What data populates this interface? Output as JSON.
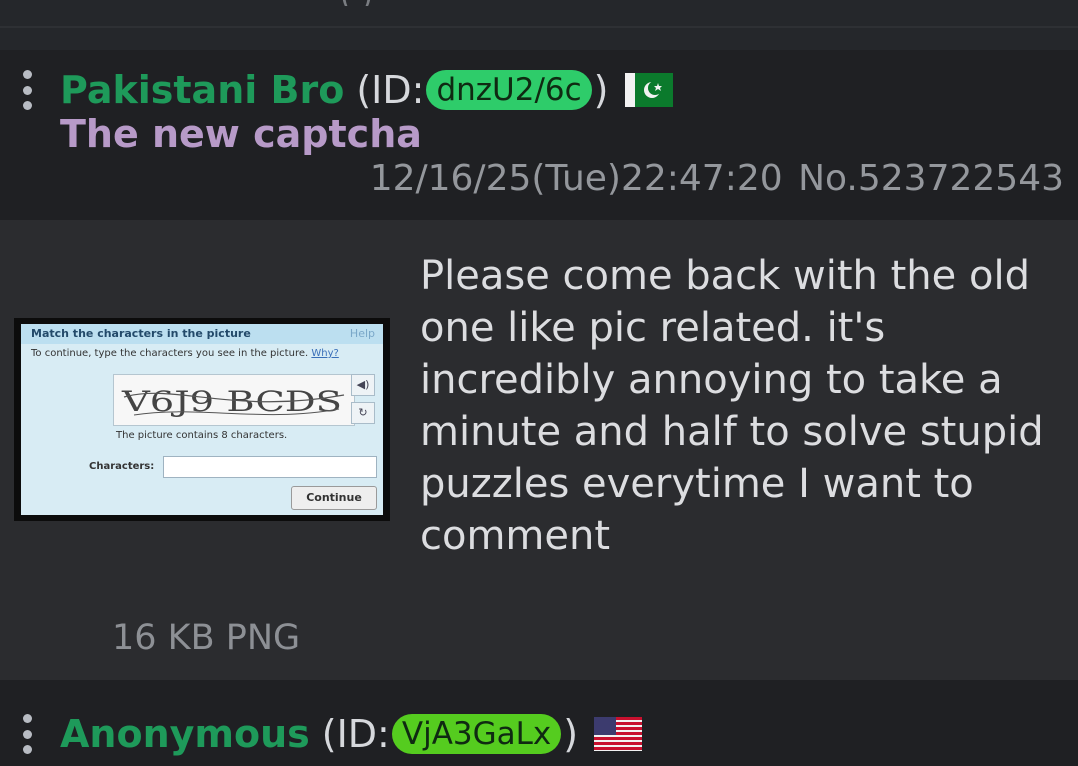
{
  "top_partial": {
    "cutoff_text": "(    )"
  },
  "posts": [
    {
      "name": "Pakistani Bro",
      "id_label": "(ID: ",
      "id": "dnzU2/6c",
      "id_close": ")",
      "id_color": "#2ecc6a",
      "flag": "pakistan-flag-icon",
      "subject": "The new captcha",
      "date": "12/16/25(Tue)22:47:20",
      "number": "No.523722543",
      "comment": "Please come back with the old one like pic related. it's incredibly annoying to take a minute and half to solve stupid puzzles everytime I want to comment",
      "file_info": "16 KB PNG",
      "thumbnail": {
        "title": "Match the characters in the picture",
        "help": "Help",
        "instruction": "To continue, type the characters you see in the picture.",
        "why": "Why?",
        "captcha_text": "V6J9 BCDS",
        "count_text": "The picture contains 8 characters.",
        "characters_label": "Characters:",
        "continue_label": "Continue"
      }
    },
    {
      "name": "Anonymous",
      "id_label": "(ID: ",
      "id": "VjA3GaLx",
      "id_close": ")",
      "id_color": "#55cc1f",
      "flag": "usa-flag-icon"
    }
  ],
  "colors": {
    "name": "#1e9a5a",
    "subject": "#b79ac8",
    "header_bg": "#1f2023",
    "body_bg": "#2b2c2f"
  }
}
